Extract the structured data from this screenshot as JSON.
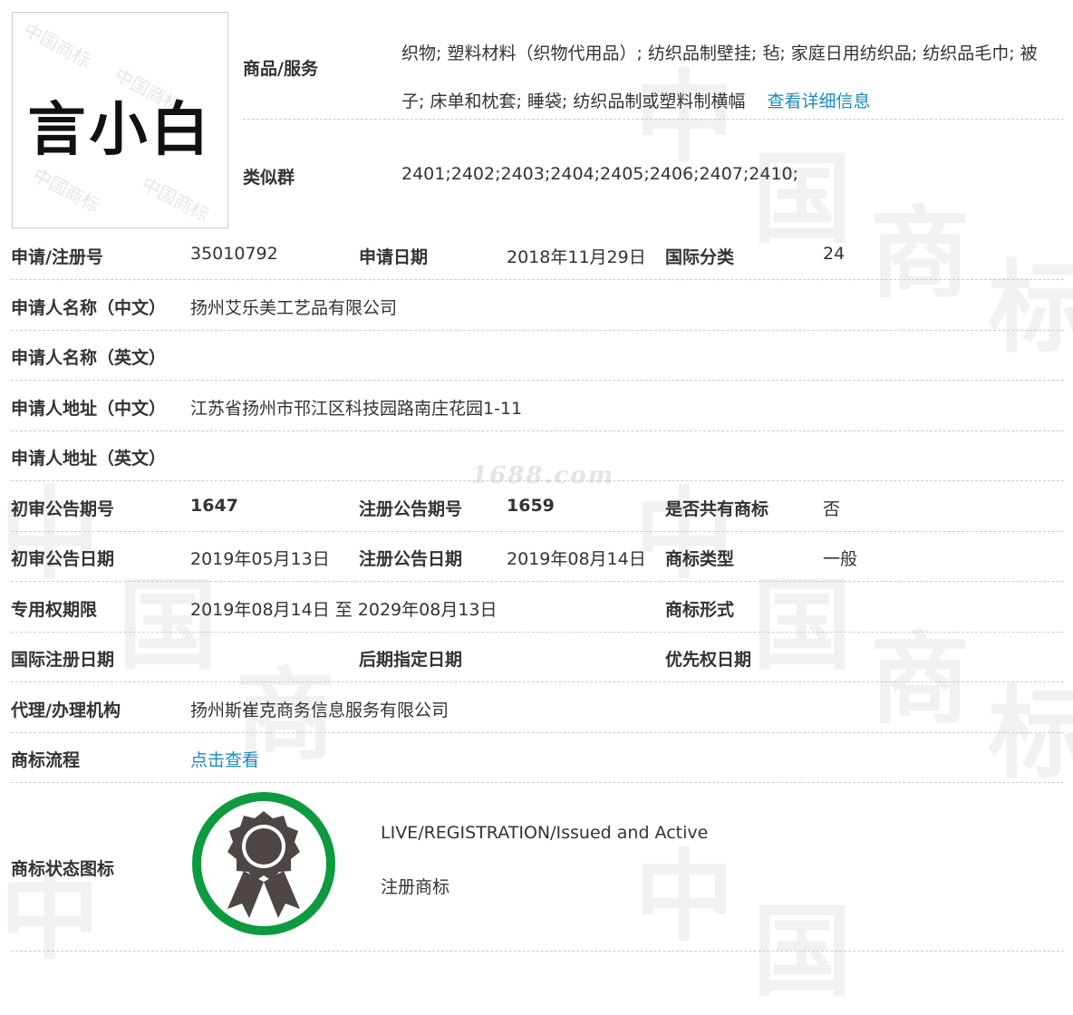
{
  "trademark_name": "言小白",
  "goods_services": {
    "label": "商品/服务",
    "value": "织物; 塑料材料（织物代用品）; 纺织品制壁挂; 毡; 家庭日用纺织品; 纺织品毛巾; 被子; 床单和枕套; 睡袋; 纺织品制或塑料制横幅",
    "detail_link": "查看详细信息"
  },
  "similar_group": {
    "label": "类似群",
    "value": "2401;2402;2403;2404;2405;2406;2407;2410;"
  },
  "registration": {
    "reg_no_label": "申请/注册号",
    "reg_no": "35010792",
    "app_date_label": "申请日期",
    "app_date": "2018年11月29日",
    "intl_class_label": "国际分类",
    "intl_class": "24"
  },
  "applicant": {
    "name_cn_label": "申请人名称（中文）",
    "name_cn": "扬州艾乐美工艺品有限公司",
    "name_en_label": "申请人名称（英文）",
    "name_en": "",
    "addr_cn_label": "申请人地址（中文）",
    "addr_cn": "江苏省扬州市邗江区科技园路南庄花园1-11",
    "addr_en_label": "申请人地址（英文）",
    "addr_en": ""
  },
  "announcements": {
    "prelim_no_label": "初审公告期号",
    "prelim_no": "1647",
    "reg_no_label": "注册公告期号",
    "reg_no": "1659",
    "shared_label": "是否共有商标",
    "shared": "否",
    "prelim_date_label": "初审公告日期",
    "prelim_date": "2019年05月13日",
    "reg_date_label": "注册公告日期",
    "reg_date": "2019年08月14日",
    "type_label": "商标类型",
    "type": "一般"
  },
  "rights": {
    "period_label": "专用权期限",
    "period": "2019年08月14日 至 2029年08月13日",
    "form_label": "商标形式",
    "form": "",
    "intl_reg_date_label": "国际注册日期",
    "intl_reg_date": "",
    "later_date_label": "后期指定日期",
    "later_date": "",
    "priority_date_label": "优先权日期",
    "priority_date": ""
  },
  "agency": {
    "label": "代理/办理机构",
    "value": "扬州斯崔克商务信息服务有限公司"
  },
  "process": {
    "label": "商标流程",
    "link": "点击查看"
  },
  "status": {
    "label": "商标状态图标",
    "english": "LIVE/REGISTRATION/Issued and Active",
    "chinese": "注册商标",
    "icon": "award-ribbon-icon",
    "ring_color": "#0e9a3e",
    "icon_color": "#4d4644"
  },
  "watermark_text": "1688.com"
}
